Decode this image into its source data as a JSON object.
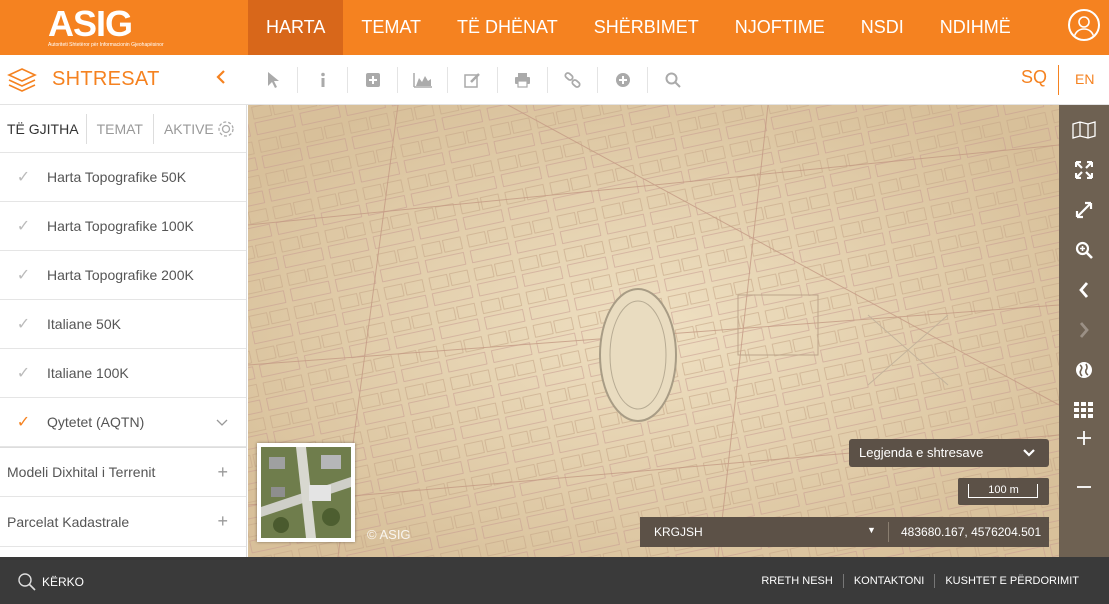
{
  "header": {
    "logo_text": "ASIG",
    "logo_subtitle": "Autoriteti Shtetëror për Informacionin Gjeohapësinor",
    "nav": [
      {
        "label": "HARTA",
        "active": true
      },
      {
        "label": "TEMAT",
        "active": false
      },
      {
        "label": "TË DHËNAT",
        "active": false
      },
      {
        "label": "SHËRBIMET",
        "active": false
      },
      {
        "label": "NJOFTIME",
        "active": false
      },
      {
        "label": "NSDI",
        "active": false
      },
      {
        "label": "NDIHMË",
        "active": false
      }
    ],
    "user_icon": "user-circle-icon"
  },
  "toolbar": {
    "title": "SHTRESAT",
    "collapse_icon": "chevron-left-icon",
    "tools": [
      "pointer-icon",
      "info-icon",
      "plus-square-icon",
      "profile-chart-icon",
      "edit-icon",
      "print-icon",
      "link-icon",
      "add-circle-icon",
      "search-icon"
    ],
    "lang_sq": "SQ",
    "lang_en": "EN"
  },
  "sidebar": {
    "tabs": [
      "TË GJITHA",
      "TEMAT",
      "AKTIVE"
    ],
    "layers": [
      {
        "label": "Harta Topografike 50K",
        "checked": false
      },
      {
        "label": "Harta Topografike 100K",
        "checked": false
      },
      {
        "label": "Harta Topografike 200K",
        "checked": false
      },
      {
        "label": "Italiane 50K",
        "checked": false
      },
      {
        "label": "Italiane 100K",
        "checked": false
      },
      {
        "label": "Qytetet (AQTN)",
        "checked": true
      }
    ],
    "groups": [
      {
        "label": "Modeli Dixhital i Terrenit"
      },
      {
        "label": "Parcelat Kadastrale"
      }
    ]
  },
  "map": {
    "copyright": "© ASIG",
    "legend_label": "Legjenda e shtresave",
    "scale_label": "100 m",
    "crs": "KRGJSH",
    "coordinates": "483680.167, 4576204.501",
    "right_tools": [
      "map-icon",
      "fullscreen-icon",
      "expand-icon",
      "zoom-in-search-icon",
      "chevron-left-icon",
      "chevron-right-icon",
      "globe-icon",
      "grid-icon",
      "zoom-plus-icon",
      "zoom-minus-icon"
    ]
  },
  "footer": {
    "search_label": "KËRKO",
    "links": [
      "RRETH NESH",
      "KONTAKTONI",
      "KUSHTET E PËRDORIMIT"
    ]
  }
}
